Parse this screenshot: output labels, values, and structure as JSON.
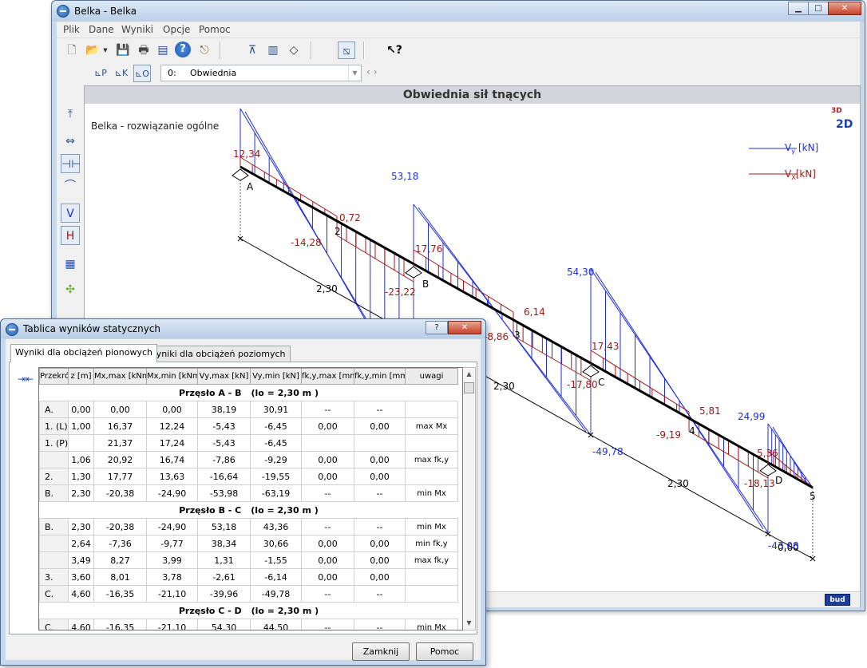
{
  "main_window": {
    "title": "Belka - Belka",
    "menu": [
      "Plik",
      "Dane",
      "Wyniki",
      "Opcje",
      "Pomoc"
    ],
    "combo": {
      "key": "0:",
      "value": "Obwiednia"
    },
    "controls": {
      "minimize": "▁",
      "maximize": "□",
      "close": "✕"
    }
  },
  "canvas": {
    "header": "Obwiednia sił tnących",
    "subtitle": "Belka - rozwiązanie ogólne",
    "view_3d": "3D",
    "view_2d": "2D",
    "legend": {
      "vy_main": "V",
      "vy_sub": "y",
      "vy_unit": "[kN]",
      "vx_main": "V",
      "vx_sub": "X",
      "vx_unit": "[kN]"
    },
    "colors": {
      "vy": "#1f2fd6",
      "vx": "#a01818",
      "beam": "#000000"
    },
    "logo": "bud"
  },
  "diagram": {
    "node_labels": [
      "A",
      "2",
      "B",
      "3",
      "C",
      "4",
      "D",
      "5"
    ],
    "span_lengths": [
      "2,30",
      "2,30",
      "2,30",
      "0,60"
    ],
    "vy_labels": [
      "53,18",
      "54,30",
      "24,99",
      "-43,08",
      "-49,78"
    ],
    "vx_labels": [
      "12,34",
      "0,72",
      "-14,28",
      "17,76",
      "-23,22",
      "6,14",
      "-8,86",
      "17,43",
      "-17,80",
      "5,81",
      "-9,19",
      "5,36",
      "-18,13"
    ]
  },
  "dialog": {
    "title": "Tablica wyników statycznych",
    "help_btn": "?",
    "close_btn": "✕",
    "tabs": [
      "Wyniki dla obciążeń pionowych",
      "Wyniki dla obciążeń poziomych"
    ],
    "headers": [
      "Przekrój",
      "z [m]",
      "Mx,max [kNm]",
      "Mx,min [kNm]",
      "Vy,max [kN]",
      "Vy,min [kN]",
      "fk,y,max [mm]",
      "fk,y,min [mm]",
      "uwagi"
    ],
    "spans": [
      {
        "label": "Przęsło A - B",
        "lo": "(lo = 2,30 m )"
      },
      {
        "label": "Przęsło B - C",
        "lo": "(lo = 2,30 m )"
      },
      {
        "label": "Przęsło C - D",
        "lo": "(lo = 2,30 m )"
      }
    ],
    "rows_ab": [
      [
        "A.",
        "0,00",
        "0,00",
        "0,00",
        "38,19",
        "30,91",
        "--",
        "--",
        ""
      ],
      [
        "1. (L)",
        "1,00",
        "16,37",
        "12,24",
        "-5,43",
        "-6,45",
        "0,00",
        "0,00",
        "max Mx"
      ],
      [
        "1. (P)",
        "",
        "21,37",
        "17,24",
        "-5,43",
        "-6,45",
        "",
        "",
        ""
      ],
      [
        "",
        "1,06",
        "20,92",
        "16,74",
        "-7,86",
        "-9,29",
        "0,00",
        "0,00",
        "max fk,y"
      ],
      [
        "2.",
        "1,30",
        "17,77",
        "13,63",
        "-16,64",
        "-19,55",
        "0,00",
        "0,00",
        ""
      ],
      [
        "B.",
        "2,30",
        "-20,38",
        "-24,90",
        "-53,98",
        "-63,19",
        "--",
        "--",
        "min Mx"
      ]
    ],
    "rows_bc": [
      [
        "B.",
        "2,30",
        "-20,38",
        "-24,90",
        "53,18",
        "43,36",
        "--",
        "--",
        "min Mx"
      ],
      [
        "",
        "2,64",
        "-7,36",
        "-9,77",
        "38,34",
        "30,66",
        "0,00",
        "0,00",
        "min fk,y"
      ],
      [
        "",
        "3,49",
        "8,27",
        "3,99",
        "1,31",
        "-1,55",
        "0,00",
        "0,00",
        "max fk,y"
      ],
      [
        "3.",
        "3,60",
        "8,01",
        "3,78",
        "-2,61",
        "-6,14",
        "0,00",
        "0,00",
        ""
      ],
      [
        "C.",
        "4,60",
        "-16,35",
        "-21,10",
        "-39,96",
        "-49,78",
        "--",
        "--",
        ""
      ]
    ],
    "rows_cd": [
      [
        "C.",
        "4,60",
        "-16,35",
        "-21,10",
        "54,30",
        "44,50",
        "--",
        "--",
        "min Mx"
      ]
    ],
    "buttons": {
      "close": "Zamknij",
      "help": "Pomoc"
    }
  }
}
